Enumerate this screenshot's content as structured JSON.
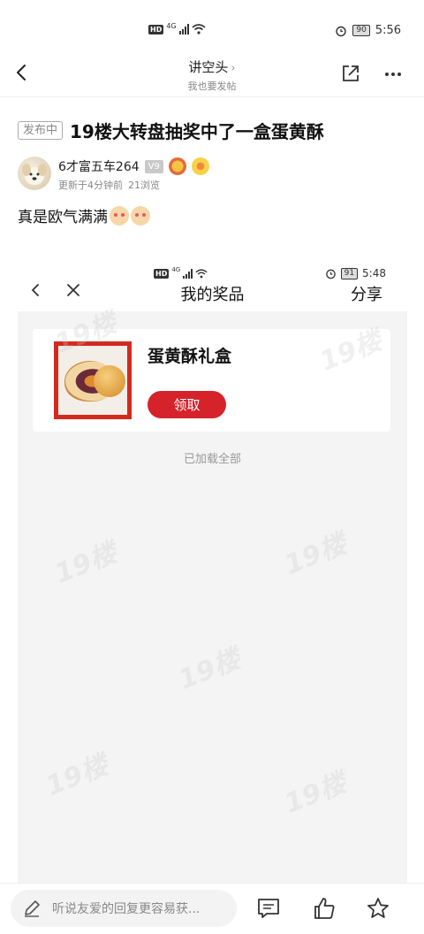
{
  "statusbar": {
    "hd": "HD",
    "network": "4G",
    "battery": "90",
    "time": "5:56"
  },
  "nav": {
    "title": "讲空头",
    "subtitle": "我也要发帖"
  },
  "post": {
    "badge": "发布中",
    "title": "19楼大转盘抽奖中了一盒蛋黄酥",
    "author": {
      "name": "6才富五车264",
      "level": "V9"
    },
    "updated": "更新于4分钟前",
    "views": "21浏览",
    "body": "真是欧气满满"
  },
  "screenshot": {
    "statusbar": {
      "hd": "HD",
      "network": "4G",
      "battery": "91",
      "time": "5:48"
    },
    "title": "我的奖品",
    "share_label": "分享",
    "prize": {
      "name": "蛋黄酥礼盒",
      "claim_label": "领取"
    },
    "loaded_all": "已加载全部",
    "watermark": "19楼"
  },
  "bottombar": {
    "reply_placeholder": "听说友爱的回复更容易获..."
  }
}
